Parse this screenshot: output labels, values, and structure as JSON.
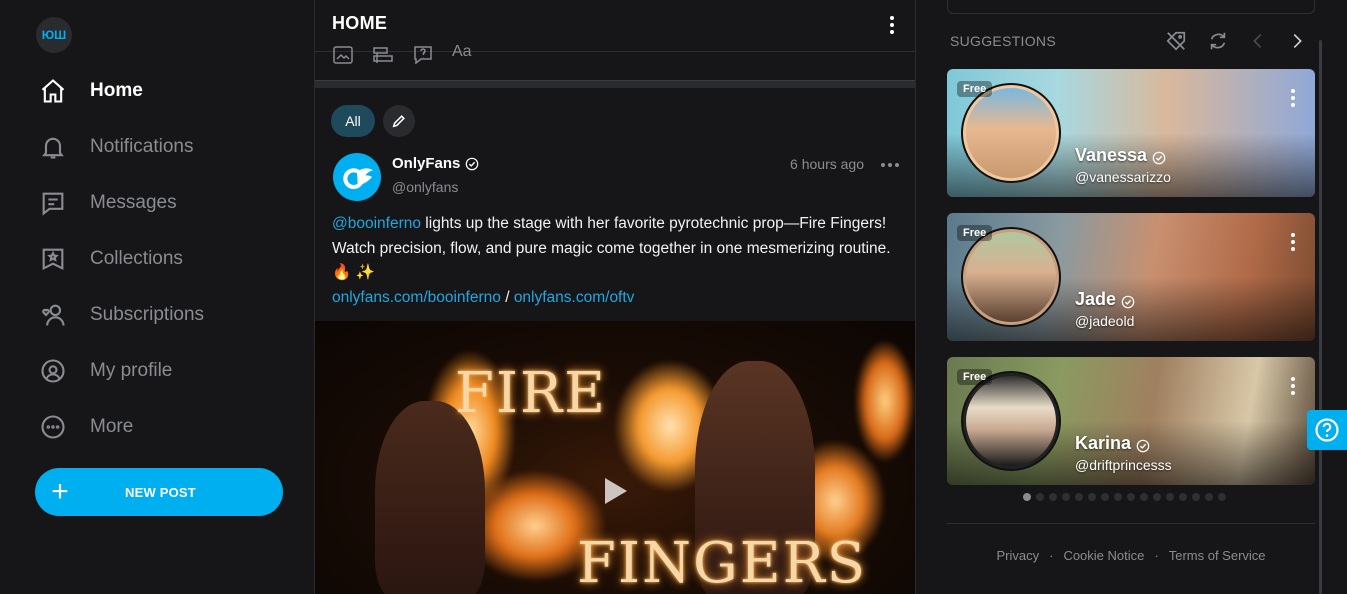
{
  "brand": {
    "avatar_text": "ЮШ",
    "accent": "#00aff0"
  },
  "sidebar": {
    "items": [
      {
        "label": "Home",
        "icon": "home-icon",
        "active": true
      },
      {
        "label": "Notifications",
        "icon": "bell-icon",
        "active": false
      },
      {
        "label": "Messages",
        "icon": "message-icon",
        "active": false
      },
      {
        "label": "Collections",
        "icon": "collections-icon",
        "active": false
      },
      {
        "label": "Subscriptions",
        "icon": "subscriptions-icon",
        "active": false
      },
      {
        "label": "My profile",
        "icon": "profile-icon",
        "active": false
      },
      {
        "label": "More",
        "icon": "more-icon",
        "active": false
      }
    ],
    "new_post_label": "NEW POST"
  },
  "feed": {
    "title": "HOME",
    "filters": {
      "all_label": "All"
    },
    "post": {
      "author": "OnlyFans",
      "handle": "@onlyfans",
      "time": "6 hours ago",
      "mention": "@booinferno",
      "text_main": " lights up the stage with her favorite pyrotechnic prop—Fire Fingers! Watch precision, flow, and pure magic come together in one mesmerizing rou­tine. 🔥 ✨",
      "link1": "onlyfans.com/booinferno",
      "link_sep": " / ",
      "link2": "onlyfans.com/oftv",
      "media": {
        "title_top": "FIRE",
        "title_bottom": "FINGERS"
      }
    }
  },
  "suggestions": {
    "header": "SUGGESTIONS",
    "cards": [
      {
        "badge": "Free",
        "name": "Vanessa",
        "handle": "@vanessarizzo"
      },
      {
        "badge": "Free",
        "name": "Jade",
        "handle": "@jadeold"
      },
      {
        "badge": "Free",
        "name": "Karina",
        "handle": "@driftprincesss"
      }
    ],
    "page_count": 16,
    "active_page": 1
  },
  "footer": {
    "links": [
      "Privacy",
      "Cookie Notice",
      "Terms of Service"
    ],
    "separator": "·"
  }
}
